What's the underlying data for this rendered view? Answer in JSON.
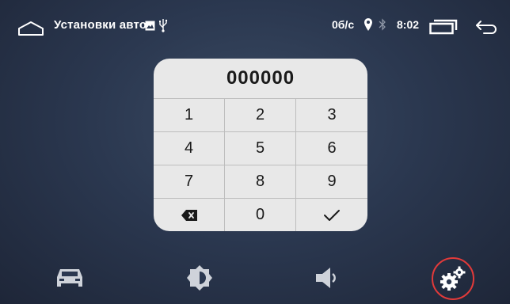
{
  "statusbar": {
    "title": "Установки авто",
    "speed": "0б/с",
    "time": "8:02"
  },
  "keypad": {
    "display": "000000",
    "keys": [
      {
        "label": "1"
      },
      {
        "label": "2"
      },
      {
        "label": "3"
      },
      {
        "label": "4"
      },
      {
        "label": "5"
      },
      {
        "label": "6"
      },
      {
        "label": "7"
      },
      {
        "label": "8"
      },
      {
        "label": "9"
      },
      {
        "icon": "backspace-icon"
      },
      {
        "label": "0"
      },
      {
        "icon": "checkmark-icon"
      }
    ]
  },
  "dock": {
    "items": [
      {
        "icon": "car-icon"
      },
      {
        "icon": "brightness-icon"
      },
      {
        "icon": "volume-icon"
      },
      {
        "icon": "settings-gears-icon",
        "selected": true,
        "highlight_color": "#e23a3a"
      }
    ]
  },
  "colors": {
    "background": "#2b3850",
    "keypad_bg": "#e8e8e8",
    "selection_ring": "#e23a3a"
  }
}
